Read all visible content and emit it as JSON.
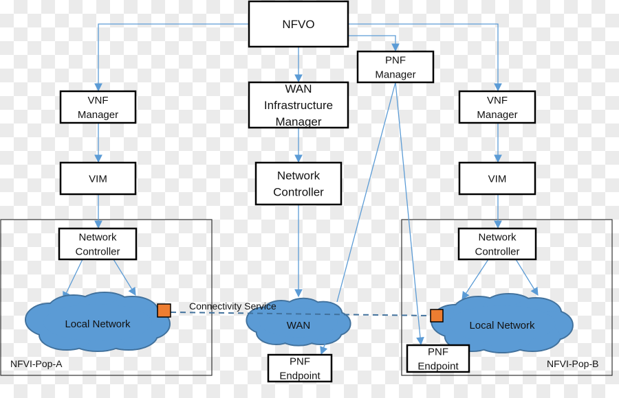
{
  "nodes": {
    "nfvo": [
      "NFVO"
    ],
    "pnf_manager": [
      "PNF",
      "Manager"
    ],
    "vnf_manager_a": [
      "VNF",
      "Manager"
    ],
    "vnf_manager_b": [
      "VNF",
      "Manager"
    ],
    "wan_infra_manager": [
      "WAN",
      "Infrastructure",
      "Manager"
    ],
    "vim_a": [
      "VIM"
    ],
    "vim_b": [
      "VIM"
    ],
    "network_controller_wan": [
      "Network",
      "Controller"
    ],
    "network_controller_a": [
      "Network",
      "Controller"
    ],
    "network_controller_b": [
      "Network",
      "Controller"
    ],
    "pnf_endpoint_wan": [
      "PNF",
      "Endpoint"
    ],
    "pnf_endpoint_b": [
      "PNF",
      "Endpoint"
    ]
  },
  "clouds": {
    "local_a": "Local Network",
    "local_b": "Local Network",
    "wan": "WAN"
  },
  "connectivity_label": "Connectivity Service",
  "pops": {
    "a": "NFVI-Pop-A",
    "b": "NFVI-Pop-B"
  },
  "colors": {
    "line": "#5b9bd5",
    "cloud": "#5b9bd5",
    "cloud_stroke": "#41719c",
    "endpoint": "#ed7d31",
    "dashed": "#41719c"
  }
}
